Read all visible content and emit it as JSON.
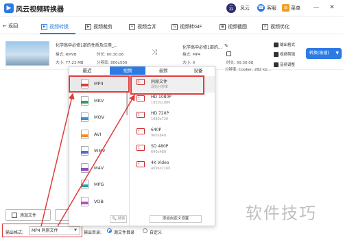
{
  "app": {
    "logo_glyph": "▶",
    "title": "风云视频转换器"
  },
  "header": {
    "avatar_glyph": "云",
    "user_name": "风云",
    "service_label": "客服",
    "menu_label": "菜单",
    "window_controls": [
      "—",
      "✕"
    ]
  },
  "toolbar": {
    "back_label": "← 返回",
    "tabs": [
      {
        "label": "视频转换",
        "icon": "convert-icon",
        "active": true
      },
      {
        "label": "视频裁剪",
        "icon": "crop-icon",
        "active": false
      },
      {
        "label": "视频合并",
        "icon": "merge-icon",
        "active": false
      },
      {
        "label": "视频转GIF",
        "icon": "gif-icon",
        "active": false
      },
      {
        "label": "视频截图",
        "icon": "screenshot-icon",
        "active": false
      },
      {
        "label": "视频优化",
        "icon": "optimize-icon",
        "active": false
      }
    ]
  },
  "file": {
    "source_name": "化学高中必修1部的性质及应用_...",
    "source_format": "格式: RMVB",
    "source_duration": "时长: 00:30:06",
    "source_size": "大小: 77.23 MB",
    "source_resolution": "分辨率: 800x500",
    "target_name": "化学高中必修1部的...",
    "target_format": "格式: MP4",
    "target_duration": "时长: 00:30:08",
    "target_size": "大小: 0",
    "target_resolution": "分辨率: Cooker, 282 kb...",
    "actions": [
      "输出格式",
      "视频剪辑",
      "音频调整"
    ],
    "convert_button": "转换(极速)"
  },
  "format_panel": {
    "tabs": [
      {
        "label": "最近",
        "active": false
      },
      {
        "label": "视频",
        "active": true
      },
      {
        "label": "音频",
        "active": false
      },
      {
        "label": "设备",
        "active": false
      }
    ],
    "formats": [
      {
        "label": "MP4",
        "color": "#e03a3a",
        "selected": true
      },
      {
        "label": "MKV",
        "color": "#2e9b5b",
        "selected": false
      },
      {
        "label": "MOV",
        "color": "#3a8fd9",
        "selected": false
      },
      {
        "label": "AVI",
        "color": "#f08a24",
        "selected": false
      },
      {
        "label": "WMV",
        "color": "#4b6fcf",
        "selected": false
      },
      {
        "label": "M4V",
        "color": "#8a4fbf",
        "selected": false
      },
      {
        "label": "MPG",
        "color": "#26a0a0",
        "selected": false
      },
      {
        "label": "VOB",
        "color": "#b34fbf",
        "selected": false
      }
    ],
    "resolutions": [
      {
        "name": "同原文件",
        "sub": "源始分辨率",
        "selected": true
      },
      {
        "name": "HD 1080P",
        "sub": "1920x1080",
        "selected": false
      },
      {
        "name": "HD 720P",
        "sub": "1080x720",
        "selected": false
      },
      {
        "name": "640P",
        "sub": "960x640",
        "selected": false
      },
      {
        "name": "SD 480P",
        "sub": "640x480",
        "selected": false
      },
      {
        "name": "4K Video",
        "sub": "4096x2160",
        "selected": false
      }
    ],
    "search_placeholder": "🔍 搜索",
    "custom_button": "添加自定义设置"
  },
  "bottom": {
    "add_file_label": "添加文件",
    "output_format_label": "输出格式:",
    "output_format_value": "MP4 同原文件",
    "output_dir_label": "输出目录:",
    "radio_source": "源文件目录",
    "radio_custom": "自定义"
  },
  "watermark": "软件技巧"
}
